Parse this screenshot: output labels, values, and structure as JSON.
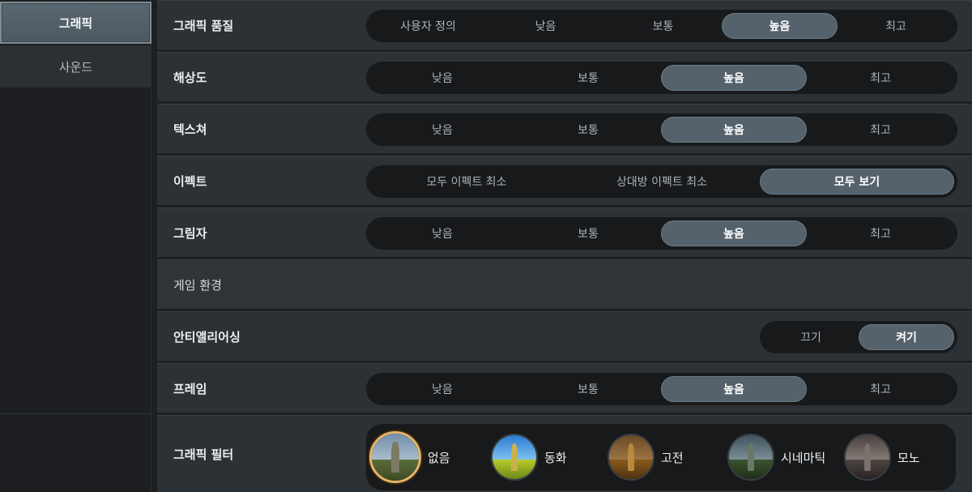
{
  "sidebar": {
    "tabs": [
      {
        "label": "그래픽",
        "active": true
      },
      {
        "label": "사운드",
        "active": false
      }
    ]
  },
  "rows": {
    "graphic_quality": {
      "label": "그래픽 품질",
      "options": [
        "사용자 정의",
        "낮음",
        "보통",
        "높음",
        "최고"
      ],
      "selected": "높음"
    },
    "resolution": {
      "label": "해상도",
      "options": [
        "낮음",
        "보통",
        "높음",
        "최고"
      ],
      "selected": "높음"
    },
    "texture": {
      "label": "텍스쳐",
      "options": [
        "낮음",
        "보통",
        "높음",
        "최고"
      ],
      "selected": "높음"
    },
    "effect": {
      "label": "이펙트",
      "options": [
        "모두 이펙트 최소",
        "상대방 이펙트 최소",
        "모두 보기"
      ],
      "selected": "모두 보기"
    },
    "shadow": {
      "label": "그림자",
      "options": [
        "낮음",
        "보통",
        "높음",
        "최고"
      ],
      "selected": "높음"
    },
    "game_env": {
      "label": "게임 환경"
    },
    "antialias": {
      "label": "안티앨리어싱",
      "options": [
        "끄기",
        "켜기"
      ],
      "selected": "켜기"
    },
    "frame": {
      "label": "프레임",
      "options": [
        "낮음",
        "보통",
        "높음",
        "최고"
      ],
      "selected": "높음"
    },
    "graphic_filter": {
      "label": "그래픽 필터",
      "options": [
        {
          "label": "없음",
          "icon": "filter-none-thumbnail"
        },
        {
          "label": "동화",
          "icon": "filter-fairytale-thumbnail"
        },
        {
          "label": "고전",
          "icon": "filter-classic-thumbnail"
        },
        {
          "label": "시네마틱",
          "icon": "filter-cinematic-thumbnail"
        },
        {
          "label": "모노",
          "icon": "filter-mono-thumbnail"
        }
      ],
      "selected": "없음"
    }
  },
  "colors": {
    "selected_option": "#55626c",
    "selected_filter_ring": "#e7b46a",
    "segment_background": "#17191b",
    "row_background": "#2c3135"
  }
}
